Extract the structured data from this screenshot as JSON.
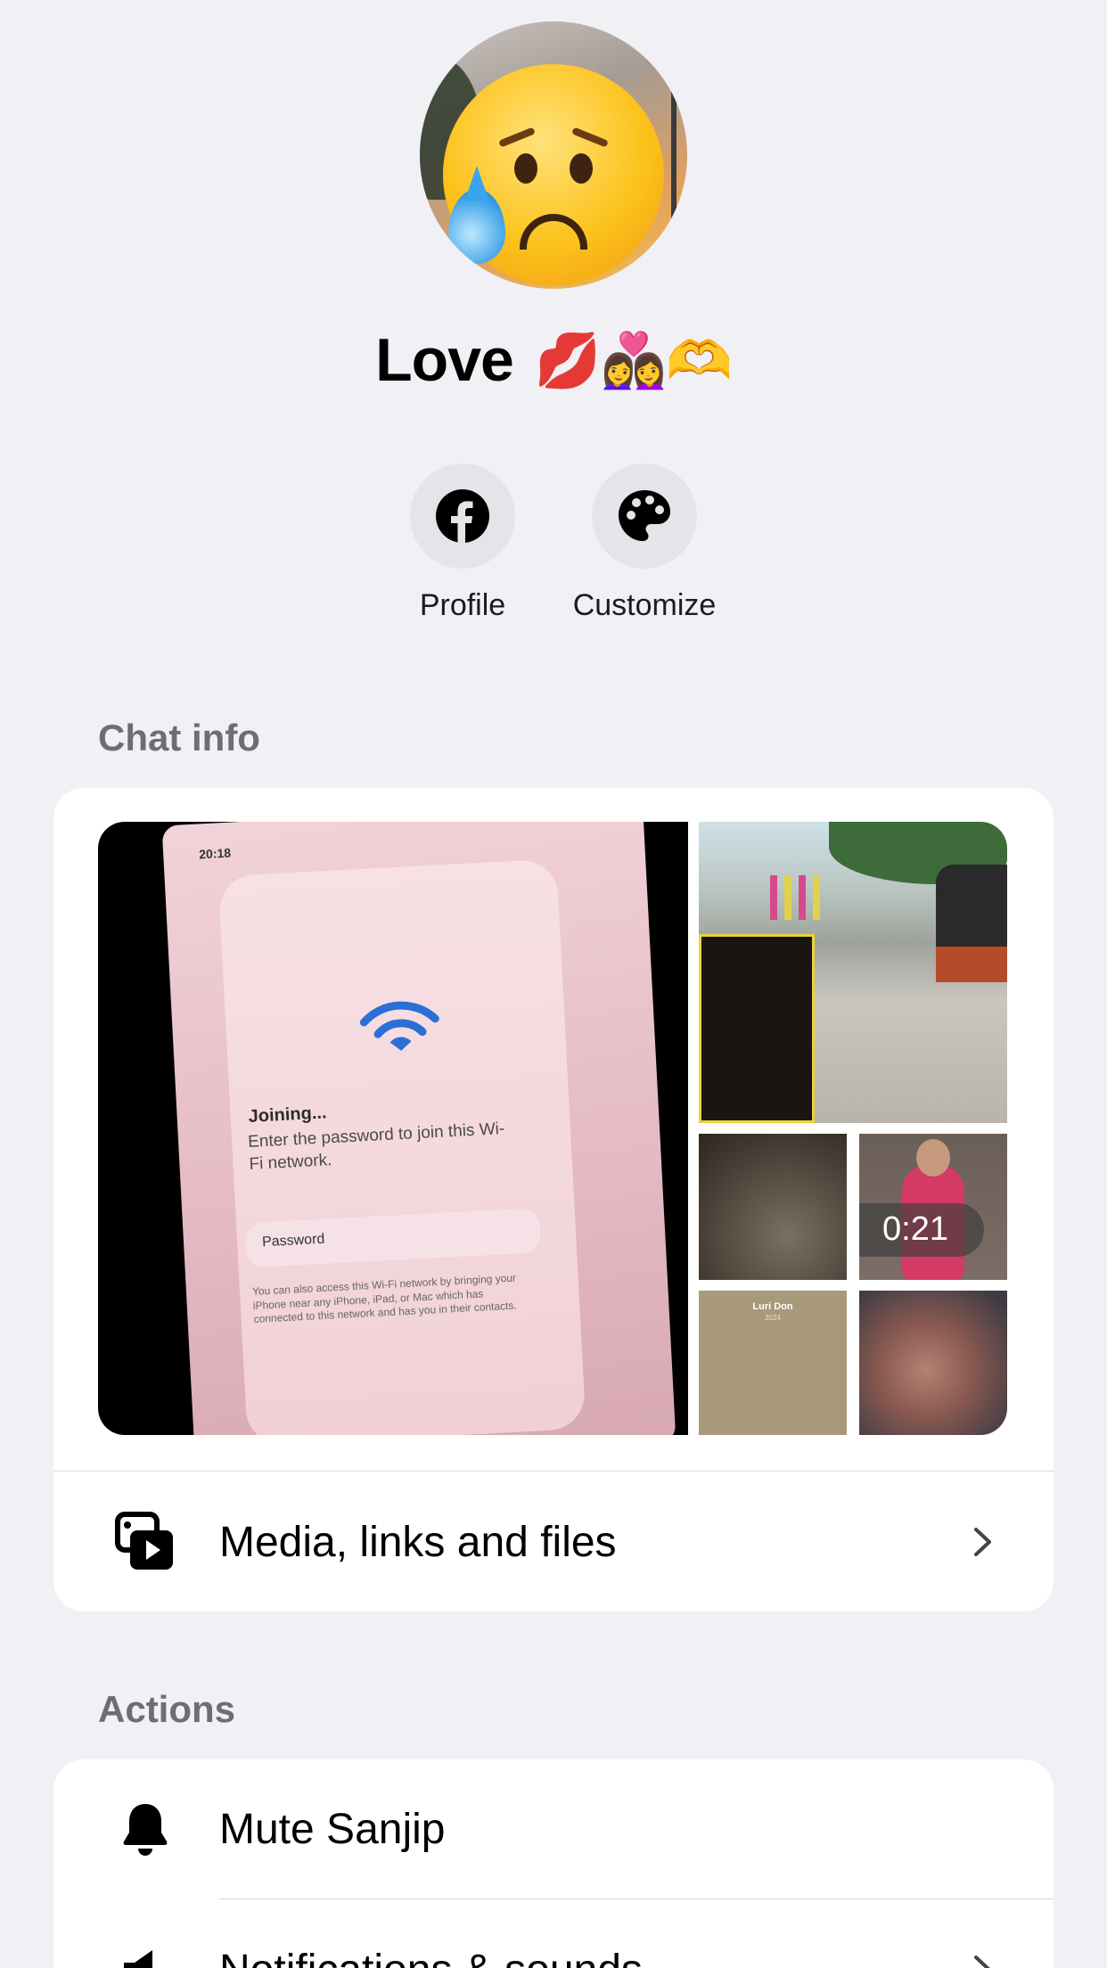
{
  "contact": {
    "name": "Love",
    "name_emoji": "💋👩‍❤️‍👩🫶"
  },
  "quick_actions": [
    {
      "label": "Profile",
      "icon": "facebook-icon"
    },
    {
      "label": "Customize",
      "icon": "palette-icon"
    }
  ],
  "chat_info": {
    "section_title": "Chat info",
    "media_preview": {
      "screenshot": {
        "time": "20:18",
        "heading": "Joining...",
        "body": "Enter the password to join this Wi-Fi network.",
        "field": "Password",
        "note": "You can also access this Wi-Fi network by bringing your iPhone near any iPhone, iPad, or Mac which has connected to this network and has you in their contacts."
      },
      "video_duration": "0:21",
      "story_caption": "Luri Don",
      "story_subcaption": "2024"
    },
    "media_row_label": "Media, links and files"
  },
  "actions": {
    "section_title": "Actions",
    "items": [
      {
        "label": "Mute Sanjip",
        "icon": "bell-icon"
      },
      {
        "label": "Notifications & sounds",
        "icon": "speaker-icon"
      }
    ]
  },
  "colors": {
    "background": "#f0f0f5",
    "card": "#ffffff",
    "section_label": "#6d6d72",
    "circle_button": "#e4e4e9"
  }
}
